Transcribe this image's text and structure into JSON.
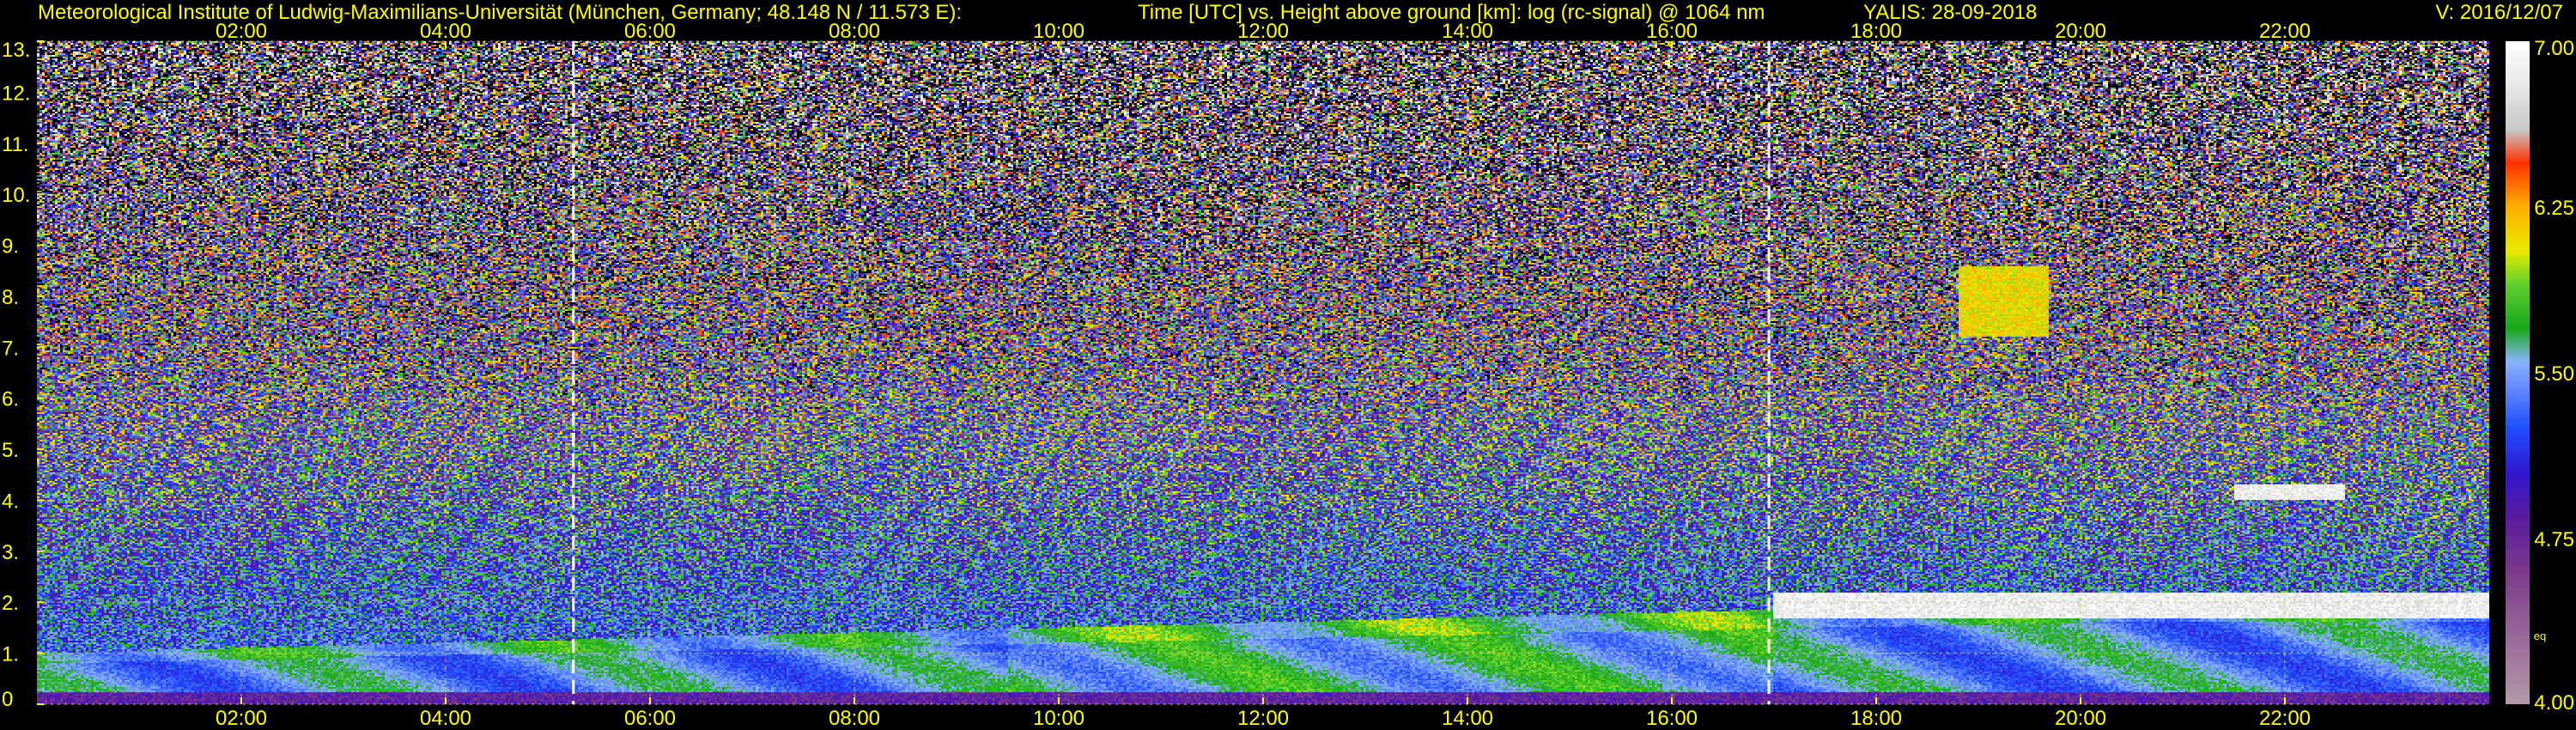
{
  "header": {
    "institute": "Meteorological Institute of Ludwig-Maximilians-Universität (München, Germany; 48.148 N / 11.573 E):",
    "plot_desc": "Time [UTC] vs. Height above ground [km]: log (rc-signal) @ 1064 nm",
    "instrument_date": "YALIS: 28-09-2018",
    "version": "V: 2016/12/07"
  },
  "colors": {
    "text": "#ffff00",
    "background": "#000000",
    "grid": "#c8c850",
    "marker_lines": "#ffffff"
  },
  "chart_data": {
    "type": "heatmap",
    "title": "Time [UTC] vs. Height above ground [km]: log (rc-signal) @ 1064 nm",
    "x": {
      "unit": "hours UTC",
      "range": [
        0.0,
        24.0
      ],
      "ticks": [
        2,
        4,
        6,
        8,
        10,
        12,
        14,
        16,
        18,
        20,
        22
      ],
      "tick_labels": [
        "02:00",
        "04:00",
        "06:00",
        "08:00",
        "10:00",
        "12:00",
        "14:00",
        "16:00",
        "18:00",
        "20:00",
        "22:00"
      ]
    },
    "y": {
      "unit": "km",
      "range": [
        0,
        13
      ],
      "ticks": [
        0,
        1,
        2,
        3,
        4,
        5,
        6,
        7,
        8,
        9,
        10,
        11,
        12,
        13
      ],
      "tick_labels": [
        "0",
        "1.",
        "2.",
        "3.",
        "4.",
        "5.",
        "6.",
        "7.",
        "8.",
        "9.",
        "10.",
        "11.",
        "12.",
        "13."
      ]
    },
    "grid": true,
    "markers_utc": [
      5.25,
      16.95
    ],
    "colorbar": {
      "range": [
        4.0,
        7.0
      ],
      "tick_values": [
        4.0,
        4.75,
        5.5,
        6.25,
        7.0
      ],
      "tick_labels": [
        "4.00",
        "4.75",
        "5.50",
        "6.25",
        "7.00"
      ],
      "unit_label": "eq",
      "stops": [
        {
          "value": 4.0,
          "color": "#b39aa8"
        },
        {
          "value": 4.3,
          "color": "#9a6a9a"
        },
        {
          "value": 4.6,
          "color": "#7a3a8a"
        },
        {
          "value": 4.85,
          "color": "#5a1aa0"
        },
        {
          "value": 5.05,
          "color": "#3018d0"
        },
        {
          "value": 5.25,
          "color": "#2050ff"
        },
        {
          "value": 5.45,
          "color": "#6a90ff"
        },
        {
          "value": 5.55,
          "color": "#8ab4ff"
        },
        {
          "value": 5.7,
          "color": "#18a818"
        },
        {
          "value": 5.9,
          "color": "#60d030"
        },
        {
          "value": 6.05,
          "color": "#e8e800"
        },
        {
          "value": 6.25,
          "color": "#ffb000"
        },
        {
          "value": 6.45,
          "color": "#ff3000"
        },
        {
          "value": 6.6,
          "color": "#c8c8c8"
        },
        {
          "value": 6.8,
          "color": "#e8e8e8"
        },
        {
          "value": 7.0,
          "color": "#ffffff"
        }
      ]
    },
    "features": [
      {
        "name": "boundary-layer",
        "time_utc": [
          0.0,
          24.0
        ],
        "top_km": [
          1.0,
          1.2,
          1.4,
          1.6,
          1.8,
          2.0,
          2.0
        ],
        "signal_approx": 5.5
      },
      {
        "name": "cloud-low",
        "time_utc": [
          17.0,
          24.0
        ],
        "height_km": [
          1.7,
          2.2
        ],
        "signal_approx": 7.0
      },
      {
        "name": "cloud-mid",
        "time_utc": [
          21.5,
          22.6
        ],
        "height_km": [
          4.0,
          4.3
        ],
        "signal_approx": 7.0
      },
      {
        "name": "cirrus",
        "time_utc": [
          18.8,
          19.7
        ],
        "height_km": [
          7.2,
          8.6
        ],
        "signal_approx": 6.25
      }
    ]
  }
}
